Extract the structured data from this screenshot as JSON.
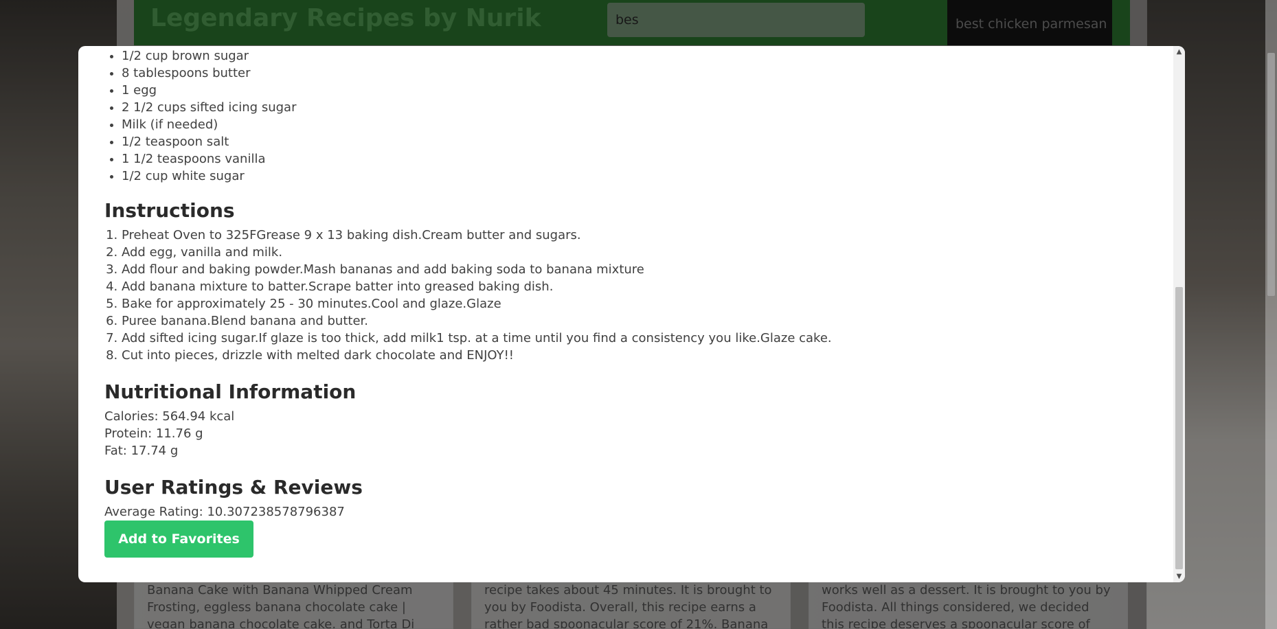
{
  "header": {
    "title": "Legendary Recipes by Nurik",
    "search_value": "bes",
    "suggestion": "best chicken parmesan"
  },
  "cards": [
    {
      "text": "Banana Cake with Banana Whipped Cream Frosting, eggless banana chocolate cake | vegan banana chocolate cake, and Torta Di"
    },
    {
      "text": "recipe takes about 45 minutes. It is brought to you by Foodista. Overall, this recipe earns a rather bad spoonacular score of 21%. Banana"
    },
    {
      "text": "works well as a dessert. It is brought to you by Foodista. All things considered, we decided this recipe deserves a spoonacular score of"
    }
  ],
  "modal": {
    "ingredients": [
      "1/2 cup brown sugar",
      "8 tablespoons butter",
      "1 egg",
      "2 1/2 cups sifted icing sugar",
      "Milk (if needed)",
      "1/2 teaspoon salt",
      "1 1/2 teaspoons vanilla",
      "1/2 cup white sugar"
    ],
    "instructions_heading": "Instructions",
    "instructions": [
      "Preheat Oven to 325FGrease 9 x 13 baking dish.Cream butter and sugars.",
      "Add egg, vanilla and milk.",
      "Add flour and baking powder.Mash bananas and add baking soda to banana mixture",
      "Add banana mixture to batter.Scrape batter into greased baking dish.",
      "Bake for approximately 25 - 30 minutes.Cool and glaze.Glaze",
      "Puree banana.Blend banana and butter.",
      "Add sifted icing sugar.If glaze is too thick, add milk1 tsp. at a time until you find a consistency you like.Glaze cake.",
      "Cut into pieces, drizzle with melted dark chocolate and ENJOY!!"
    ],
    "nutrition_heading": "Nutritional Information",
    "nutrition": {
      "calories": "Calories: 564.94 kcal",
      "protein": "Protein: 11.76 g",
      "fat": "Fat: 17.74 g"
    },
    "reviews_heading": "User Ratings & Reviews",
    "average_rating": "Average Rating: 10.307238578796387",
    "favorite_button": "Add to Favorites"
  },
  "colors": {
    "header_green": "#2f7d32",
    "button_green": "#2ec46b"
  }
}
